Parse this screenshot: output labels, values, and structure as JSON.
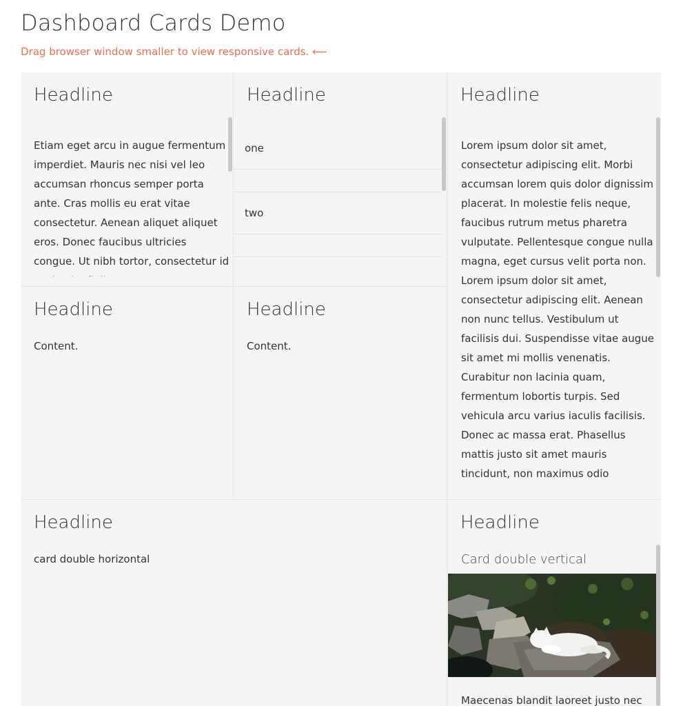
{
  "page": {
    "title": "Dashboard Cards Demo",
    "subtitle": "Drag browser window smaller to view responsive cards. ⟵"
  },
  "cards": [
    {
      "headline": "Headline",
      "text": "Etiam eget arcu in augue fermentum imperdiet. Mauris nec nisi vel leo accumsan rhoncus semper porta ante. Cras mollis eu erat vitae consectetur. Aenean aliquet aliquet eros. Donec faucibus ultricies congue. Ut nibh tortor, consectetur id sapien in, finibus"
    },
    {
      "headline": "Headline",
      "list": [
        "one",
        "two"
      ]
    },
    {
      "headline": "Headline",
      "text": "Lorem ipsum dolor sit amet, consectetur adipiscing elit. Morbi accumsan lorem quis dolor dignissim placerat. In molestie felis neque, faucibus rutrum metus pharetra vulputate. Pellentesque congue nulla magna, eget cursus velit porta non. Lorem ipsum dolor sit amet, consectetur adipiscing elit. Aenean non nunc tellus. Vestibulum ut facilisis dui. Suspendisse vitae augue sit amet mi mollis venenatis. Curabitur non lacinia quam, fermentum lobortis turpis. Sed vehicula arcu varius iaculis facilisis. Donec ac massa erat. Phasellus mattis justo sit amet mauris tincidunt, non maximus odio sollicitudin. Ut aliquam orci eget"
    },
    {
      "headline": "Headline",
      "text": "Content."
    },
    {
      "headline": "Headline",
      "text": "Content."
    },
    {
      "headline": "Headline",
      "text": "card double horizontal"
    },
    {
      "headline": "Headline",
      "subheading": "Card double vertical",
      "image_alt": "white cat lying on a rock in a garden",
      "text": "Maecenas blandit laoreet justo nec"
    }
  ]
}
